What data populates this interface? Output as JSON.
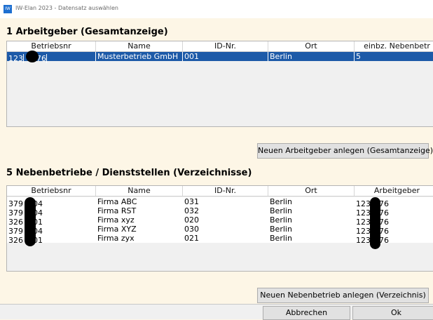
{
  "window": {
    "icon_text": "IW",
    "title": "IW-Elan 2023 - Datensatz auswählen"
  },
  "employers": {
    "title": "1 Arbeitgeber (Gesamtanzeige)",
    "columns": [
      "Betriebsnr",
      "Name",
      "ID-Nr.",
      "Ort",
      "einbz. Nebenbetr"
    ],
    "rows": [
      {
        "betriebsnr_a": "123",
        "betriebsnr_b": "76",
        "name": "Musterbetrieb GmbH",
        "id": "001",
        "ort": "Berlin",
        "extra": "5"
      }
    ],
    "new_button": "Neuen Arbeitgeber anlegen (Gesamtanzeige)"
  },
  "branches": {
    "title": "5 Nebenbetriebe / Dienststellen (Verzeichnisse)",
    "columns": [
      "Betriebsnr",
      "Name",
      "ID-Nr.",
      "Ort",
      "Arbeitgeber"
    ],
    "rows": [
      {
        "betriebsnr_a": "379",
        "betriebsnr_b": "04",
        "name": "Firma ABC",
        "id": "031",
        "ort": "Berlin",
        "ag_a": "123",
        "ag_b": "76"
      },
      {
        "betriebsnr_a": "379",
        "betriebsnr_b": "04",
        "name": "Firma RST",
        "id": "032",
        "ort": "Berlin",
        "ag_a": "123",
        "ag_b": "76"
      },
      {
        "betriebsnr_a": "326",
        "betriebsnr_b": "01",
        "name": "Firma xyz",
        "id": "020",
        "ort": "Berlin",
        "ag_a": "123",
        "ag_b": "76"
      },
      {
        "betriebsnr_a": "379",
        "betriebsnr_b": "04",
        "name": "Firma XYZ",
        "id": "030",
        "ort": "Berlin",
        "ag_a": "123",
        "ag_b": "76"
      },
      {
        "betriebsnr_a": "326",
        "betriebsnr_b": "01",
        "name": "Firma zyx",
        "id": "021",
        "ort": "Berlin",
        "ag_a": "123",
        "ag_b": "76"
      }
    ],
    "new_button": "Neuen Nebenbetrieb anlegen (Verzeichnis)"
  },
  "footer": {
    "cancel": "Abbrechen",
    "ok": "Ok"
  }
}
